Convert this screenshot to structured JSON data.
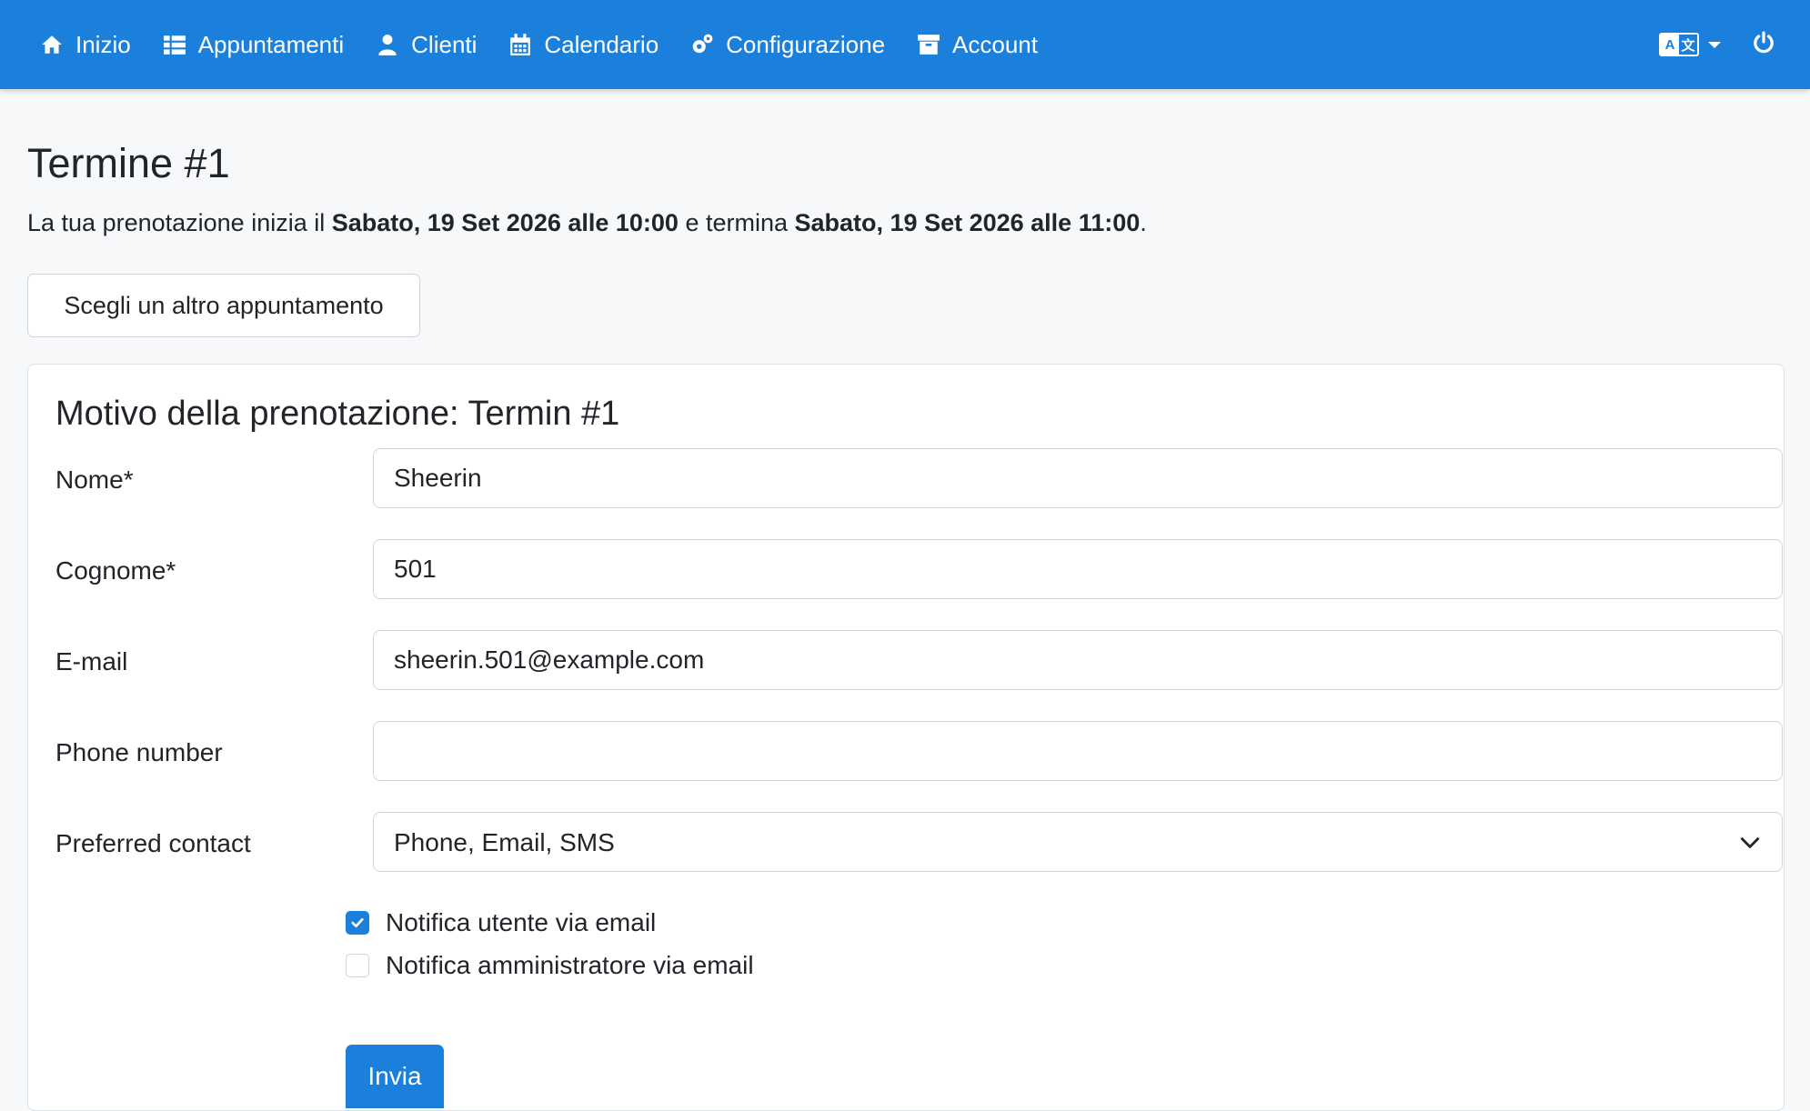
{
  "nav": {
    "items": [
      {
        "label": "Inizio",
        "icon": "home-icon"
      },
      {
        "label": "Appuntamenti",
        "icon": "list-icon"
      },
      {
        "label": "Clienti",
        "icon": "user-icon"
      },
      {
        "label": "Calendario",
        "icon": "calendar-icon"
      },
      {
        "label": "Configurazione",
        "icon": "gears-icon"
      },
      {
        "label": "Account",
        "icon": "archive-icon"
      }
    ],
    "language_icon": "language-icon",
    "power_icon": "power-icon"
  },
  "page": {
    "title": "Termine #1",
    "intro_prefix": "La tua prenotazione inizia il ",
    "start": "Sabato, 19 Set 2026 alle 10:00",
    "intro_mid": " e termina ",
    "end": "Sabato, 19 Set 2026 alle 11:00",
    "intro_suffix": ".",
    "alt_button": "Scegli un altro appuntamento"
  },
  "form": {
    "title": "Motivo della prenotazione: Termin #1",
    "fields": [
      {
        "label": "Nome*",
        "value": "Sheerin"
      },
      {
        "label": "Cognome*",
        "value": "501"
      },
      {
        "label": "E-mail",
        "value": "sheerin.501@example.com"
      },
      {
        "label": "Phone number",
        "value": ""
      },
      {
        "label": "Preferred contact",
        "value": "Phone, Email, SMS"
      }
    ],
    "checkboxes": [
      {
        "label": "Notifica utente via email",
        "checked": true
      },
      {
        "label": "Notifica amministratore via email",
        "checked": false
      }
    ],
    "submit": "Invia"
  },
  "colors": {
    "primary": "#1b7fdc",
    "background": "#f7f8f9"
  }
}
